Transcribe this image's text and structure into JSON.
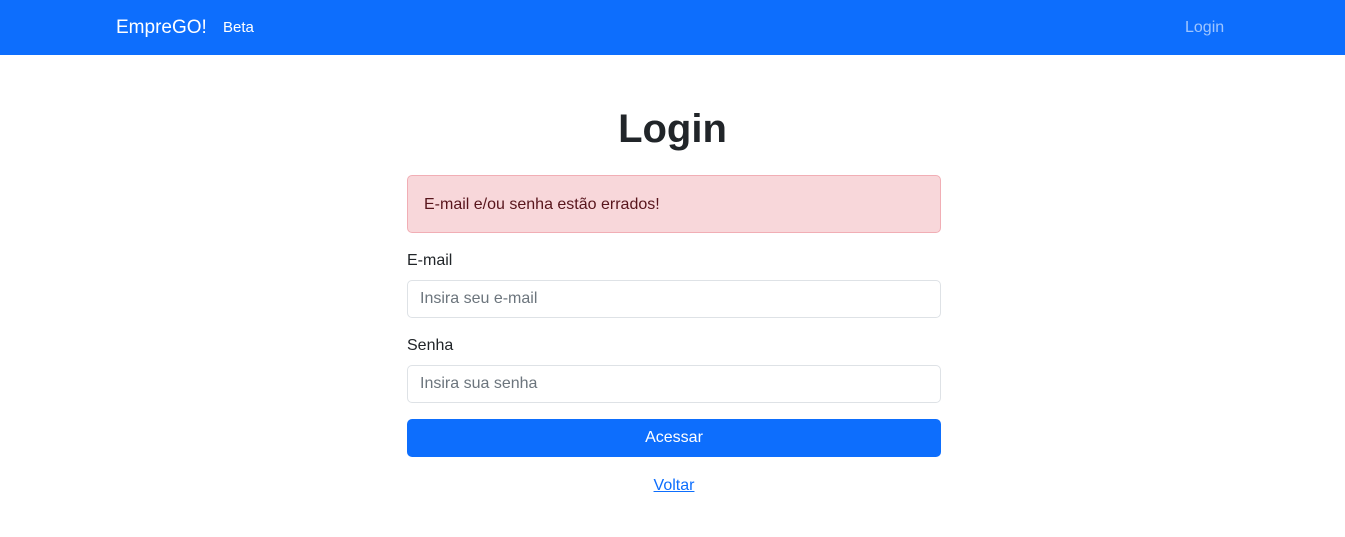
{
  "navbar": {
    "brand": "EmpreGO!",
    "beta_label": "Beta",
    "login_link": "Login",
    "background_color": "#0d6efd"
  },
  "page": {
    "title": "Login"
  },
  "alert": {
    "message": "E-mail e/ou senha estão errados!",
    "type": "danger"
  },
  "form": {
    "email": {
      "label": "E-mail",
      "placeholder": "Insira seu e-mail",
      "value": ""
    },
    "password": {
      "label": "Senha",
      "placeholder": "Insira sua senha",
      "value": ""
    },
    "submit_label": "Acessar",
    "back_link": "Voltar"
  }
}
